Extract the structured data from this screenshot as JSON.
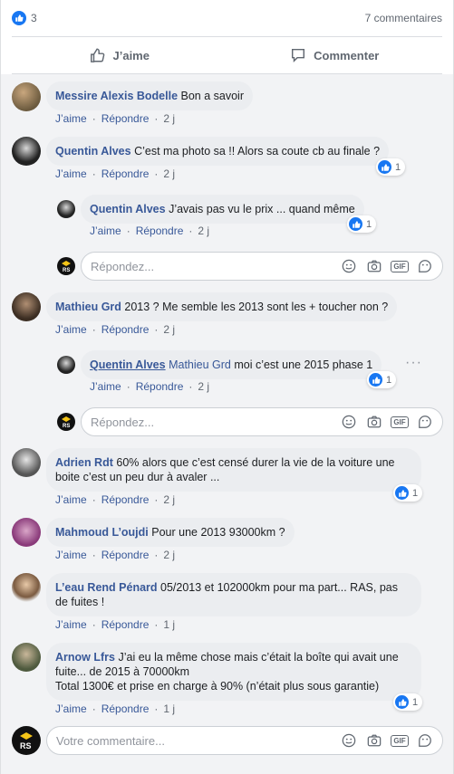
{
  "summary": {
    "likes": "3",
    "comments": "7 commentaires"
  },
  "actions": {
    "like": "J’aime",
    "comment": "Commenter"
  },
  "labels": {
    "like": "J’aime",
    "reply": "Répondre"
  },
  "comments": [
    {
      "author": "Messire Alexis Bodelle",
      "text": "Bon a savoir",
      "time": "2 j"
    },
    {
      "author": "Quentin Alves",
      "text": "C’est ma photo sa !! Alors sa coute cb au finale ?",
      "time": "2 j",
      "reactions": "1",
      "replies": [
        {
          "author": "Quentin Alves",
          "text": "J’avais pas vu le prix ... quand même",
          "time": "2 j",
          "reactions": "1"
        }
      ]
    },
    {
      "author": "Mathieu Grd",
      "text": "2013 ? Me semble les 2013 sont les + toucher non ?",
      "time": "2 j",
      "replies": [
        {
          "author": "Quentin Alves",
          "mention": "Mathieu Grd",
          "text": "moi c’est une 2015 phase 1",
          "time": "2 j",
          "reactions": "1"
        }
      ]
    },
    {
      "author": "Adrien Rdt",
      "text": "60% alors que c’est censé durer la vie de la voiture une boite c’est un peu dur à avaler ...",
      "time": "2 j",
      "reactions": "1"
    },
    {
      "author": "Mahmoud L’oujdi",
      "text": "Pour une 2013 93000km ?",
      "time": "2 j"
    },
    {
      "author": "L’eau Rend Pénard",
      "text": "05/2013 et 102000km pour ma part... RAS, pas de fuites !",
      "time": "1 j"
    },
    {
      "author": "Arnow Lfrs",
      "text": "J’ai eu la même chose mais c’était la boîte qui avait une fuite... de 2015 à 70000km",
      "text2": "Total 1300€ et prise en charge à 90% (n’était plus sous garantie)",
      "time": "1 j",
      "reactions": "1"
    }
  ],
  "reply_placeholder": "Répondez...",
  "comment_placeholder": "Votre commentaire...",
  "gif_label": "GIF",
  "colors": {
    "link": "#385898",
    "bubble": "#ebedf0",
    "like_blue": "#1877f2",
    "background": "#f2f3f5"
  },
  "icons": [
    "thumbs-up-icon",
    "comment-icon",
    "emoji-icon",
    "camera-icon",
    "gif-icon",
    "sticker-icon",
    "more-options-icon"
  ]
}
